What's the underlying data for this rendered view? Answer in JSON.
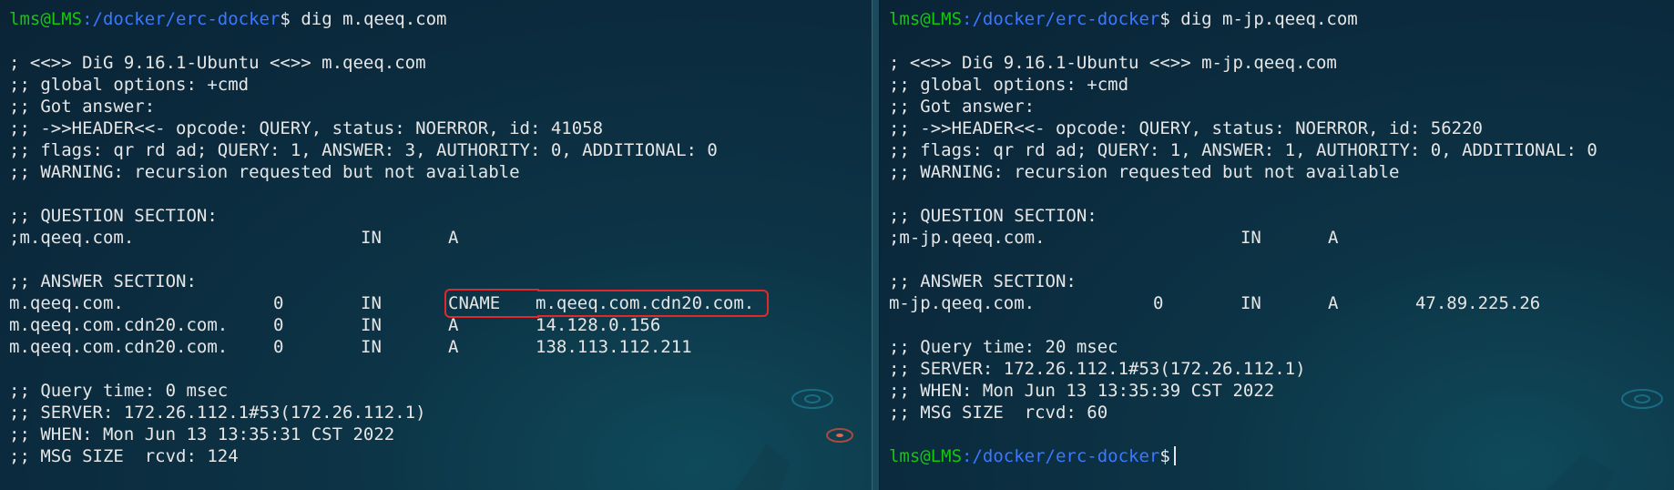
{
  "left": {
    "prompt": {
      "user": "lms@LMS",
      "path": ":/docker/erc-docker",
      "symbol": "$",
      "command": " dig m.qeeq.com"
    },
    "header": [
      "; <<>> DiG 9.16.1-Ubuntu <<>> m.qeeq.com",
      ";; global options: +cmd",
      ";; Got answer:",
      ";; ->>HEADER<<- opcode: QUERY, status: NOERROR, id: 41058",
      ";; flags: qr rd ad; QUERY: 1, ANSWER: 3, AUTHORITY: 0, ADDITIONAL: 0",
      ";; WARNING: recursion requested but not available"
    ],
    "question_title": ";; QUESTION SECTION:",
    "question": {
      "name": ";m.qeeq.com.",
      "class": "IN",
      "type": "A"
    },
    "answer_title": ";; ANSWER SECTION:",
    "answers": [
      {
        "name": "m.qeeq.com.",
        "ttl": "0",
        "class": "IN",
        "type": "CNAME",
        "value": "m.qeeq.com.cdn20.com."
      },
      {
        "name": "m.qeeq.com.cdn20.com.",
        "ttl": "0",
        "class": "IN",
        "type": "A",
        "value": "14.128.0.156"
      },
      {
        "name": "m.qeeq.com.cdn20.com.",
        "ttl": "0",
        "class": "IN",
        "type": "A",
        "value": "138.113.112.211"
      }
    ],
    "footer": [
      ";; Query time: 0 msec",
      ";; SERVER: 172.26.112.1#53(172.26.112.1)",
      ";; WHEN: Mon Jun 13 13:35:31 CST 2022",
      ";; MSG SIZE  rcvd: 124"
    ],
    "highlight_color": "#e02a2a"
  },
  "right": {
    "prompt": {
      "user": "lms@LMS",
      "path": ":/docker/erc-docker",
      "symbol": "$",
      "command": " dig m-jp.qeeq.com"
    },
    "header": [
      "; <<>> DiG 9.16.1-Ubuntu <<>> m-jp.qeeq.com",
      ";; global options: +cmd",
      ";; Got answer:",
      ";; ->>HEADER<<- opcode: QUERY, status: NOERROR, id: 56220",
      ";; flags: qr rd ad; QUERY: 1, ANSWER: 1, AUTHORITY: 0, ADDITIONAL: 0",
      ";; WARNING: recursion requested but not available"
    ],
    "question_title": ";; QUESTION SECTION:",
    "question": {
      "name": ";m-jp.qeeq.com.",
      "class": "IN",
      "type": "A"
    },
    "answer_title": ";; ANSWER SECTION:",
    "answers": [
      {
        "name": "m-jp.qeeq.com.",
        "ttl": "0",
        "class": "IN",
        "type": "A",
        "value": "47.89.225.26"
      }
    ],
    "footer": [
      ";; Query time: 20 msec",
      ";; SERVER: 172.26.112.1#53(172.26.112.1)",
      ";; WHEN: Mon Jun 13 13:35:39 CST 2022",
      ";; MSG SIZE  rcvd: 60"
    ],
    "final_prompt": {
      "user": "lms@LMS",
      "path": ":/docker/erc-docker",
      "symbol": "$"
    }
  },
  "colors": {
    "user": "#16c60c",
    "path": "#3b78ff",
    "text": "#e6e6e6",
    "background": "#0c2a3e"
  },
  "icons": [
    "terminal-cursor-icon"
  ]
}
